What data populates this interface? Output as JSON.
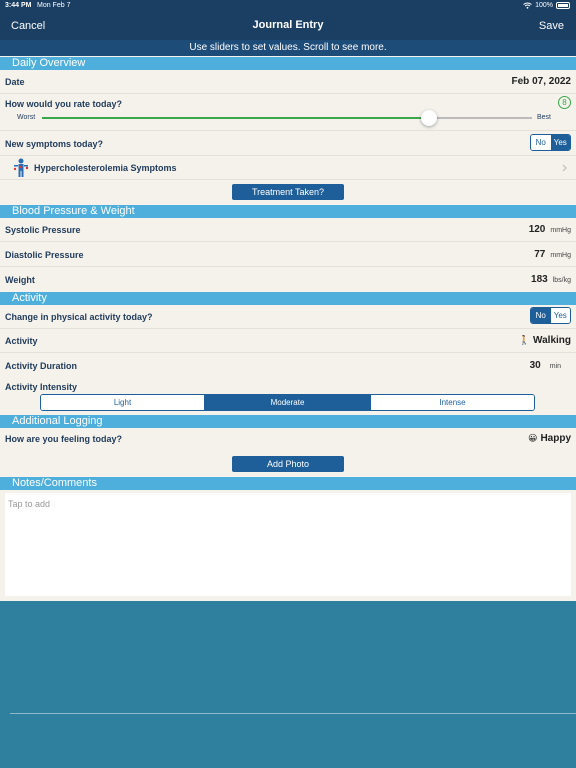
{
  "status": {
    "time": "3:44 PM",
    "date": "Mon Feb 7",
    "battery": "100%"
  },
  "nav": {
    "cancel": "Cancel",
    "title": "Journal Entry",
    "save": "Save"
  },
  "hint": "Use sliders to set values. Scroll to see more.",
  "daily": {
    "header": "Daily Overview",
    "date_label": "Date",
    "date_value": "Feb 07, 2022",
    "rate_label": "How would you rate today?",
    "rate_value": "8",
    "rate_fraction": 0.8,
    "worst": "Worst",
    "best": "Best",
    "symptoms_label": "New symptoms today?",
    "no": "No",
    "yes": "Yes",
    "symptoms_selected": "Yes",
    "condition": "Hypercholesterolemia Symptoms",
    "treatment_button": "Treatment Taken?"
  },
  "bp": {
    "header": "Blood Pressure & Weight",
    "systolic_label": "Systolic Pressure",
    "systolic_value": "120",
    "systolic_unit": "mmHg",
    "diastolic_label": "Diastolic Pressure",
    "diastolic_value": "77",
    "diastolic_unit": "mmHg",
    "weight_label": "Weight",
    "weight_value": "183",
    "weight_unit": "lbs/kg"
  },
  "activity": {
    "header": "Activity",
    "change_label": "Change in physical activity today?",
    "no": "No",
    "yes": "Yes",
    "change_selected": "No",
    "activity_label": "Activity",
    "activity_icon": "🚶",
    "activity_value": "Walking",
    "duration_label": "Activity Duration",
    "duration_value": "30",
    "duration_unit": "min",
    "intensity_label": "Activity Intensity",
    "intensity_options": [
      "Light",
      "Moderate",
      "Intense"
    ],
    "intensity_selected": "Moderate"
  },
  "logging": {
    "header": "Additional Logging",
    "feeling_label": "How are you feeling today?",
    "feeling_icon": "😀",
    "feeling_value": "Happy",
    "photo_button": "Add Photo"
  },
  "notes": {
    "header": "Notes/Comments",
    "placeholder": "Tap to add"
  },
  "colors": {
    "nav": "#1b3f63",
    "section": "#4eaedc",
    "accent": "#1e5f99",
    "slider": "#3aa84a"
  }
}
